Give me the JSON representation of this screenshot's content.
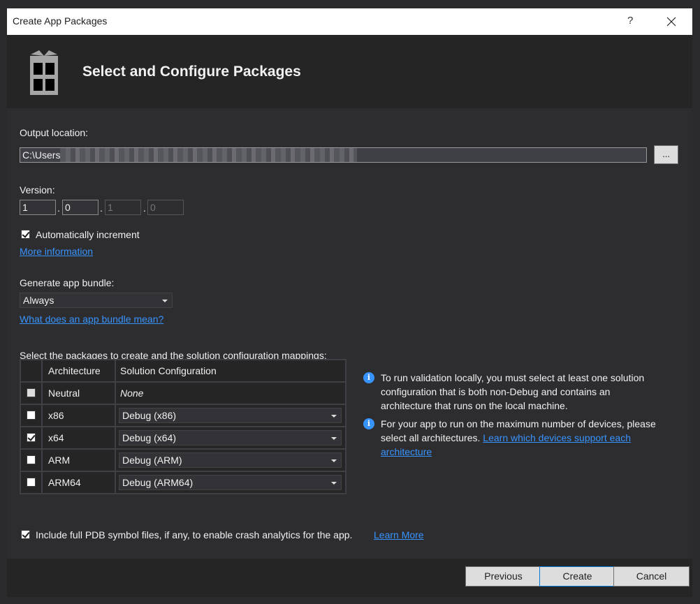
{
  "window": {
    "title": "Create App Packages",
    "help_label": "?",
    "close_icon": "close-icon"
  },
  "header": {
    "title": "Select and Configure Packages",
    "icon": "package-icon"
  },
  "output": {
    "label": "Output location:",
    "value_visible": "C:\\Users",
    "value_tail": "\\",
    "browse_label": "..."
  },
  "version": {
    "label": "Version:",
    "parts": [
      "1",
      "0",
      "1",
      "0"
    ],
    "separator": ".",
    "auto_increment_label": "Automatically increment",
    "auto_increment_checked": true,
    "more_info_link": "More information"
  },
  "bundle": {
    "label": "Generate app bundle:",
    "selected": "Always",
    "help_link": "What does an app bundle mean?"
  },
  "packages": {
    "label": "Select the packages to create and the solution configuration mappings:",
    "columns": [
      "",
      "Architecture",
      "Solution Configuration"
    ],
    "rows": [
      {
        "checked": false,
        "disabled": true,
        "architecture": "Neutral",
        "configuration": "None"
      },
      {
        "checked": false,
        "disabled": false,
        "architecture": "x86",
        "configuration": "Debug (x86)"
      },
      {
        "checked": true,
        "disabled": false,
        "architecture": "x64",
        "configuration": "Debug (x64)"
      },
      {
        "checked": false,
        "disabled": false,
        "architecture": "ARM",
        "configuration": "Debug (ARM)"
      },
      {
        "checked": false,
        "disabled": false,
        "architecture": "ARM64",
        "configuration": "Debug (ARM64)"
      }
    ]
  },
  "info": [
    {
      "icon": "info-icon",
      "text": "To run validation locally, you must select at least one solution configuration that is both non-Debug and contains an architecture that runs on the local machine.",
      "link": ""
    },
    {
      "icon": "info-icon",
      "text": "For your app to run on the maximum number of devices, please select all architectures.",
      "link": "Learn which devices support each architecture"
    }
  ],
  "pdb": {
    "checked": true,
    "label": "Include full PDB symbol files, if any, to enable crash analytics for the app.",
    "link": "Learn More"
  },
  "footer": {
    "previous": "Previous",
    "create": "Create",
    "cancel": "Cancel"
  },
  "colors": {
    "link": "#3794ff",
    "info": "#3794ff",
    "default_button_border": "#0078d7"
  }
}
